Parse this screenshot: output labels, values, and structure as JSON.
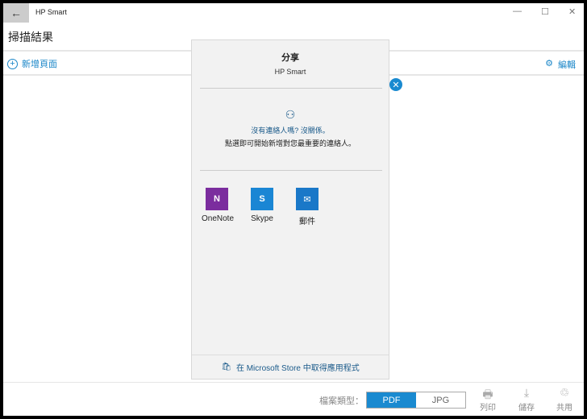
{
  "window": {
    "app_title": "HP Smart",
    "back": "←",
    "minimize": "—",
    "maximize": "☐",
    "close": "✕"
  },
  "page_title": "掃描結果",
  "toolbar": {
    "add_page": "新增頁面",
    "edit": "編輯"
  },
  "share": {
    "title": "分享",
    "subtitle": "HP Smart",
    "no_contacts": "沒有連絡人嗎? 沒關係。",
    "hint": "點選即可開始新增對您最重要的連絡人。",
    "apps": [
      {
        "label": "OneNote",
        "color": "#7b2d9e",
        "glyph": "N"
      },
      {
        "label": "Skype",
        "color": "#1a86d4",
        "glyph": "S"
      },
      {
        "label": "郵件",
        "color": "#1a78c8",
        "glyph": "✉"
      }
    ],
    "store_link": "在 Microsoft Store 中取得應用程式"
  },
  "bottom": {
    "file_type_label": "檔案類型：",
    "options": [
      "PDF",
      "JPG"
    ],
    "selected": "PDF",
    "print": "列印",
    "save": "儲存",
    "share": "共用"
  }
}
